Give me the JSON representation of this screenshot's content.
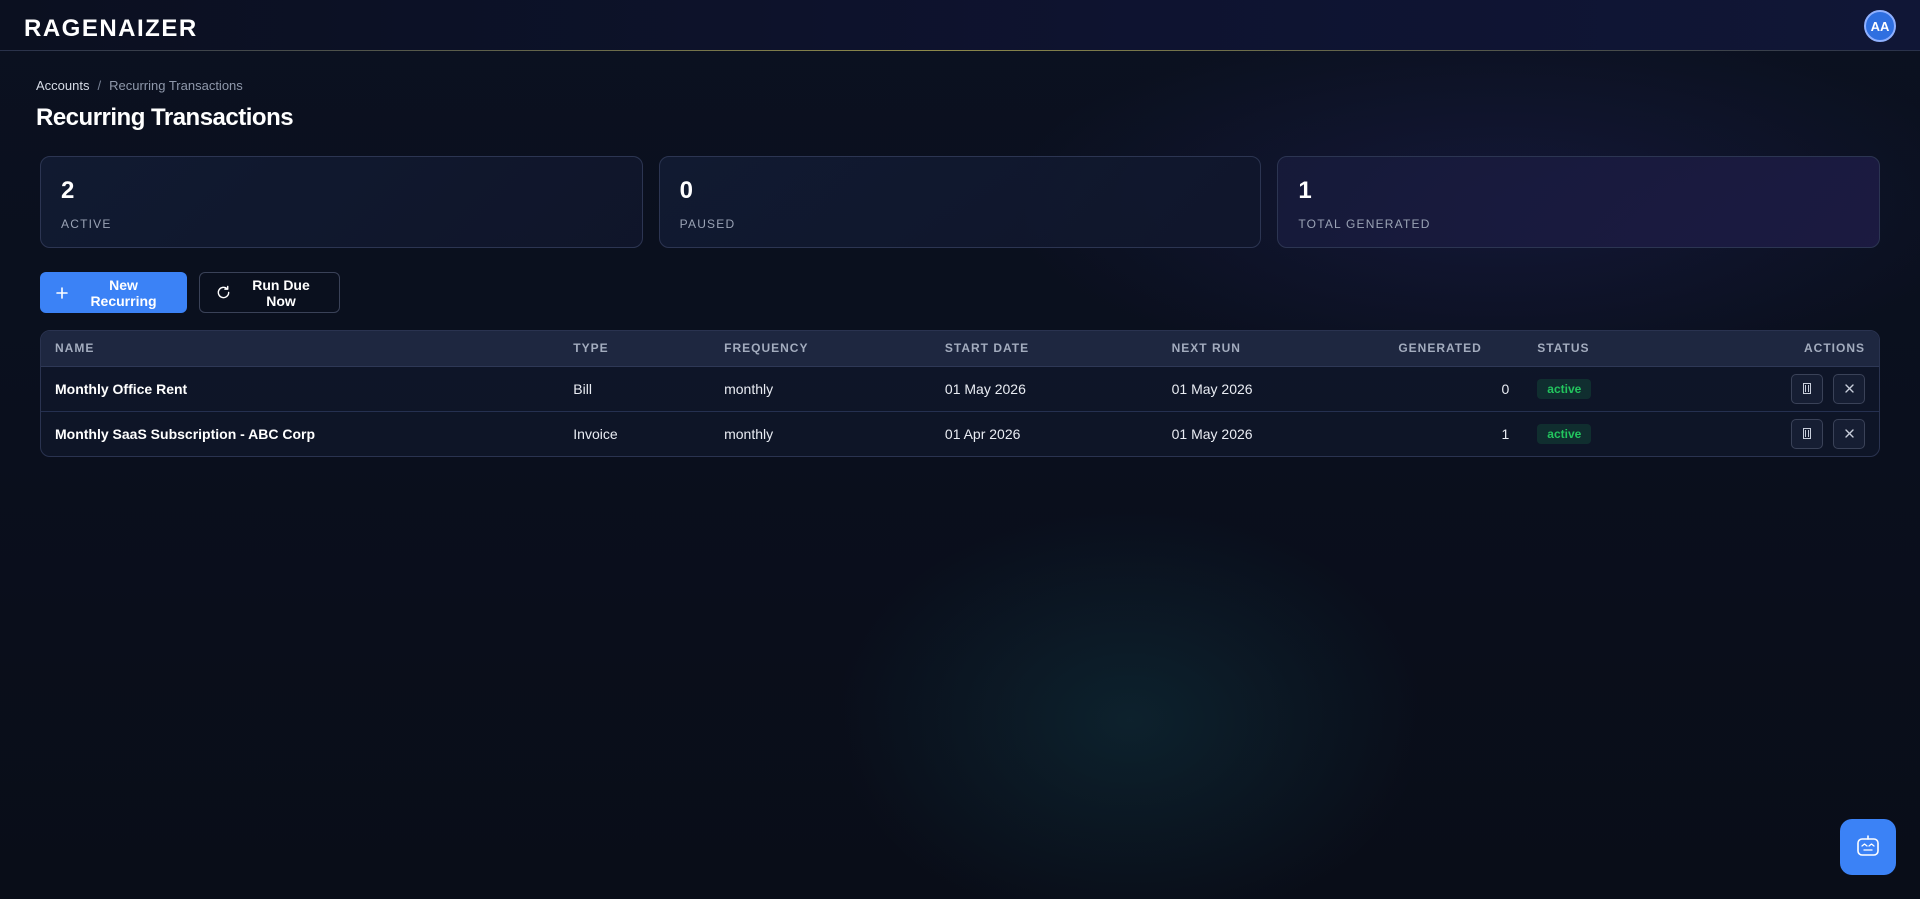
{
  "header": {
    "logo_text": "RAGENAIZER",
    "avatar_initials": "AA"
  },
  "breadcrumb": {
    "parent": "Accounts",
    "separator": "/",
    "current": "Recurring Transactions"
  },
  "page_title": "Recurring Transactions",
  "stats": [
    {
      "value": "2",
      "label": "ACTIVE"
    },
    {
      "value": "0",
      "label": "PAUSED"
    },
    {
      "value": "1",
      "label": "TOTAL GENERATED"
    }
  ],
  "toolbar": {
    "new_label": "New Recurring",
    "run_label": "Run Due Now"
  },
  "table": {
    "columns": [
      "NAME",
      "TYPE",
      "FREQUENCY",
      "START DATE",
      "NEXT RUN",
      "GENERATED",
      "STATUS",
      "ACTIONS"
    ],
    "rows": [
      {
        "name": "Monthly Office Rent",
        "type": "Bill",
        "frequency": "monthly",
        "start_date": "01 May 2026",
        "next_run": "01 May 2026",
        "generated": "0",
        "status": "active"
      },
      {
        "name": "Monthly SaaS Subscription - ABC Corp",
        "type": "Invoice",
        "frequency": "monthly",
        "start_date": "01 Apr 2026",
        "next_run": "01 May 2026",
        "generated": "1",
        "status": "active"
      }
    ]
  },
  "colors": {
    "accent": "#3b82f6",
    "status_active": "#22c55e",
    "background": "#0a0f1d"
  },
  "icons": {
    "add": "plus-icon",
    "run": "refresh-icon",
    "pause": "pause-icon",
    "delete": "close-icon",
    "assistant": "assistant-icon"
  }
}
